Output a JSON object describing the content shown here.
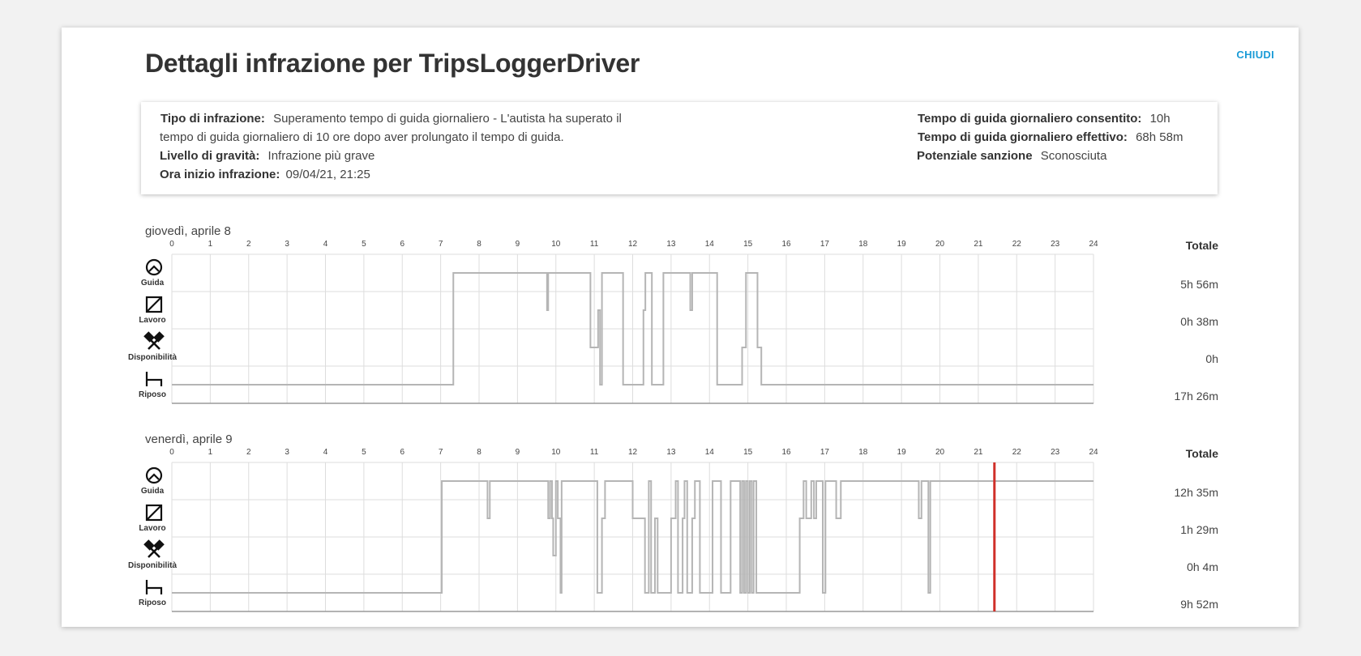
{
  "dialog": {
    "title": "Dettagli infrazione per TripsLoggerDriver",
    "close_label": "CHIUDI"
  },
  "infraction": {
    "type_label": "Tipo di infrazione:",
    "type_value_line1": "Superamento tempo di guida giornaliero -  L'autista ha superato il",
    "type_value_line2": "tempo di guida giornaliero di 10 ore dopo aver prolungato il tempo di guida.",
    "severity_label": "Livello di gravità:",
    "severity_value": "Infrazione più grave",
    "start_label": "Ora inizio infrazione:",
    "start_value": "09/04/21, 21:25",
    "allowed_label": "Tempo di guida giornaliero consentito:",
    "allowed_value": "10h",
    "actual_label": "Tempo di guida giornaliero effettivo:",
    "actual_value": "68h 58m",
    "penalty_label": "Potenziale sanzione",
    "penalty_value": "Sconosciuta"
  },
  "legend": {
    "rows": [
      {
        "label": "Guida",
        "icon": "steering-wheel-icon"
      },
      {
        "label": "Lavoro",
        "icon": "work-square-icon"
      },
      {
        "label": "Disponibilità",
        "icon": "crossed-hammers-icon"
      },
      {
        "label": "Riposo",
        "icon": "bed-icon"
      }
    ],
    "total_label": "Totale"
  },
  "hours": [
    "0",
    "1",
    "2",
    "3",
    "4",
    "5",
    "6",
    "7",
    "8",
    "9",
    "10",
    "11",
    "12",
    "13",
    "14",
    "15",
    "16",
    "17",
    "18",
    "19",
    "20",
    "21",
    "22",
    "23",
    "24"
  ],
  "colors": {
    "activity_line": "#b5b5b5",
    "grid": "#dddddd",
    "infraction_marker": "#d0302a"
  },
  "chart_data": [
    {
      "type": "line",
      "date_label": "giovedì, aprile 8",
      "xlim": [
        0,
        24
      ],
      "states": [
        "Guida",
        "Lavoro",
        "Disponibilità",
        "Riposo"
      ],
      "totals": [
        "5h 56m",
        "0h 38m",
        "0h",
        "17h 26m"
      ],
      "steps": [
        [
          0,
          3
        ],
        [
          7.33,
          0
        ],
        [
          9.77,
          1
        ],
        [
          9.8,
          0
        ],
        [
          10.9,
          2
        ],
        [
          11.1,
          1
        ],
        [
          11.15,
          3
        ],
        [
          11.2,
          0
        ],
        [
          11.75,
          3
        ],
        [
          12.28,
          1
        ],
        [
          12.33,
          0
        ],
        [
          12.5,
          3
        ],
        [
          12.8,
          0
        ],
        [
          13.5,
          1
        ],
        [
          13.55,
          0
        ],
        [
          14.2,
          3
        ],
        [
          14.85,
          2
        ],
        [
          14.95,
          0
        ],
        [
          15.25,
          2
        ],
        [
          15.35,
          3
        ],
        [
          24,
          3
        ]
      ]
    },
    {
      "type": "line",
      "date_label": "venerdì, aprile 9",
      "xlim": [
        0,
        24
      ],
      "states": [
        "Guida",
        "Lavoro",
        "Disponibilità",
        "Riposo"
      ],
      "totals": [
        "12h 35m",
        "1h 29m",
        "0h 4m",
        "9h 52m"
      ],
      "infraction_time": 21.42,
      "steps": [
        [
          0,
          3
        ],
        [
          7.03,
          0
        ],
        [
          8.22,
          1
        ],
        [
          8.28,
          0
        ],
        [
          9.8,
          1
        ],
        [
          9.85,
          0
        ],
        [
          9.9,
          1
        ],
        [
          9.93,
          2
        ],
        [
          10.0,
          0
        ],
        [
          10.05,
          1
        ],
        [
          10.12,
          3
        ],
        [
          10.15,
          0
        ],
        [
          11.08,
          3
        ],
        [
          11.2,
          1
        ],
        [
          11.28,
          0
        ],
        [
          12.0,
          1
        ],
        [
          12.32,
          3
        ],
        [
          12.42,
          0
        ],
        [
          12.48,
          3
        ],
        [
          12.58,
          1
        ],
        [
          12.65,
          3
        ],
        [
          13.0,
          1
        ],
        [
          13.12,
          0
        ],
        [
          13.18,
          3
        ],
        [
          13.3,
          1
        ],
        [
          13.35,
          0
        ],
        [
          13.42,
          3
        ],
        [
          13.55,
          1
        ],
        [
          13.62,
          0
        ],
        [
          13.75,
          3
        ],
        [
          14.08,
          0
        ],
        [
          14.3,
          3
        ],
        [
          14.55,
          0
        ],
        [
          14.8,
          3
        ],
        [
          14.85,
          0
        ],
        [
          14.9,
          3
        ],
        [
          14.95,
          0
        ],
        [
          15.0,
          3
        ],
        [
          15.05,
          0
        ],
        [
          15.1,
          3
        ],
        [
          15.15,
          0
        ],
        [
          15.22,
          3
        ],
        [
          16.35,
          1
        ],
        [
          16.45,
          0
        ],
        [
          16.52,
          1
        ],
        [
          16.65,
          0
        ],
        [
          16.72,
          1
        ],
        [
          16.78,
          0
        ],
        [
          16.95,
          3
        ],
        [
          17.02,
          0
        ],
        [
          17.3,
          1
        ],
        [
          17.42,
          0
        ],
        [
          19.45,
          1
        ],
        [
          19.52,
          0
        ],
        [
          19.7,
          3
        ],
        [
          19.75,
          0
        ],
        [
          24,
          0
        ]
      ]
    }
  ]
}
